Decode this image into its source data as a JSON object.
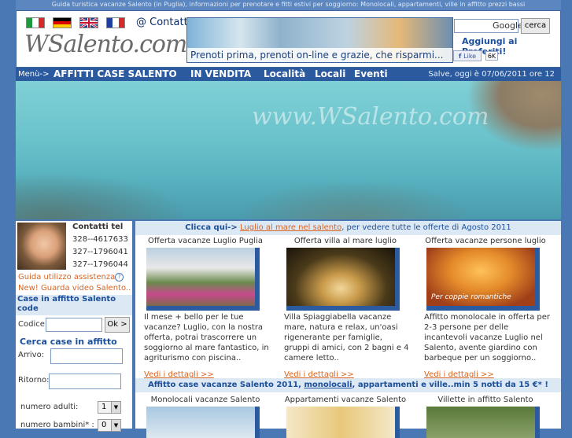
{
  "topstrip": "Guida turistica vacanze Salento (in Puglia), informazioni per prenotare e fitti estivi per soggiorno: Monolocali, appartamenti, ville in affitto prezzi bassi",
  "header": {
    "logo": "WSalento.com",
    "contatti": "@ Contatti",
    "banner_caption": "Prenoti prima, prenoti on-line e grazie, che risparmi...",
    "google_label": "Google",
    "search_button": "cerca",
    "preferiti": "Aggiungi ai Preferiti!",
    "like_label": "Like",
    "like_count": "6K"
  },
  "nav": {
    "menu": "Menù->",
    "items": [
      "AFFITTI CASE SALENTO",
      "IN VENDITA",
      "Località",
      "Locali",
      "Eventi"
    ],
    "greeting": "Salve, oggi è 07/06/2011 ore 12"
  },
  "sidebar": {
    "contatti_title": "Contatti tel",
    "phones": [
      "328--4617633",
      "327--1796041",
      "327--1796044"
    ],
    "guida": "Guida utilizzo assistenza",
    "help_icon": "?",
    "video": "New! Guarda video Salento..",
    "case_code_title": "Case in affitto Salento code",
    "codice_label": "Codice",
    "ok_button": "Ok >",
    "cerca_title": "Cerca case in affitto",
    "arrivo_label": "Arrivo:",
    "ritorno_label": "Ritorno:",
    "adulti_label": "numero adulti:",
    "adulti_value": "1",
    "bambini_label": "numero bambini* :",
    "bambini_value": "0"
  },
  "main": {
    "bar1": {
      "prefix": "Clicca qui->",
      "link": "Luglio al mare nel salento",
      "suffix": ", per vedere tutte le offerte di Agosto 2011"
    },
    "offers": [
      {
        "title": "Offerta vacanze Luglio Puglia",
        "desc": "Il mese + bello per le tue vacanze? Luglio, con la nostra offerta, potrai trascorrere un soggiorno al mare fantastico, in agriturismo con piscina..",
        "link": "Vedi i dettagli >>"
      },
      {
        "title": "Offerta villa al mare luglio",
        "desc": "Villa Spiaggiabella vacanze mare, natura e relax, un'oasi rigenerante per famiglie, gruppi di amici, con 2 bagni e 4 camere letto..",
        "link": "Vedi i dettagli >>"
      },
      {
        "title": "Offerta vacanze persone luglio",
        "desc": "Affitto monolocale in offerta per 2-3 persone per delle incantevoli vacanze Luglio nel Salento, avente giardino con barbeque per un soggiorno..",
        "link": "Vedi i dettagli >>",
        "pic_caption": "Per coppie romantiche"
      }
    ],
    "bar2": {
      "prefix": "Affitto case  vacanze Salento 2011, ",
      "link": "monolocali",
      "suffix": ", appartamenti e ville..min 5 notti da 15 €* !"
    },
    "row2": [
      {
        "title": "Monolocali vacanze Salento"
      },
      {
        "title": "Appartamenti vacanze Salento"
      },
      {
        "title": "Villette in affitto Salento"
      }
    ]
  },
  "colors": {
    "page_bg": "#4a78b4",
    "nav_bg": "#2b5a9e",
    "accent_orange": "#d9631f",
    "section_bg": "#dde8f5"
  }
}
